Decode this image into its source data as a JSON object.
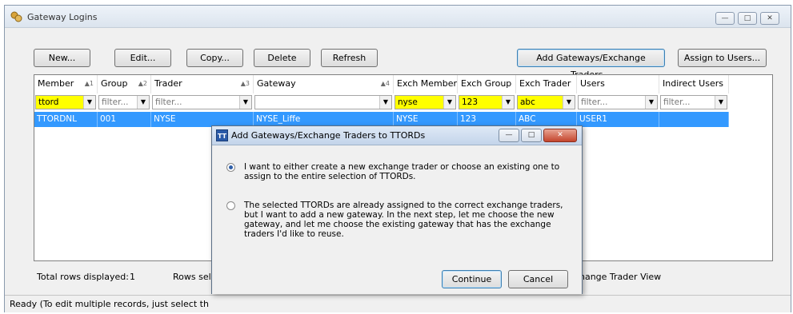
{
  "window": {
    "title": "Gateway Logins",
    "controls": [
      "minimize-icon",
      "maximize-icon",
      "close-icon"
    ]
  },
  "toolbar": {
    "new_label": "New...",
    "edit_label": "Edit...",
    "copy_label": "Copy...",
    "delete_label": "Delete",
    "refresh_label": "Refresh",
    "add_gateways_label": "Add Gateways/Exchange Traders...",
    "assign_users_label": "Assign to Users..."
  },
  "grid": {
    "columns": [
      {
        "label": "Member",
        "sort": "▲1"
      },
      {
        "label": "Group",
        "sort": "▲2"
      },
      {
        "label": "Trader",
        "sort": "▲3"
      },
      {
        "label": "Gateway",
        "sort": "▲4"
      },
      {
        "label": "Exch Member",
        "sort": ""
      },
      {
        "label": "Exch Group",
        "sort": ""
      },
      {
        "label": "Exch Trader",
        "sort": ""
      },
      {
        "label": "Users",
        "sort": ""
      },
      {
        "label": "Indirect Users",
        "sort": ""
      }
    ],
    "filters": [
      "ttord",
      "filter...",
      "filter...",
      "",
      "nyse",
      "123",
      "abc",
      "filter...",
      "filter..."
    ],
    "highlight_color": "#ffff00",
    "selected_row_color": "#3399ff",
    "rows": [
      [
        "TTORDNL",
        "001",
        "NYSE",
        "NYSE_Liffe",
        "NYSE",
        "123",
        "ABC",
        "USER1",
        ""
      ]
    ]
  },
  "footer": {
    "total_rows_label": "Total rows displayed:",
    "total_rows_value": "1",
    "rows_selected_partial": "Rows sele",
    "view_partial": "hange Trader View"
  },
  "status": {
    "text_partial": "Ready (To edit multiple records, just select th"
  },
  "dialog": {
    "title": "Add Gateways/Exchange Traders to TTORDs",
    "icon_text": "TT",
    "option1": "I want to either create a new exchange trader or choose an existing one to assign to the entire selection of TTORDs.",
    "option2": "The selected TTORDs are already assigned to the correct exchange traders, but I want to add a new gateway. In the next step, let me choose the new gateway, and let me choose the existing gateway that has the exchange traders I'd like to reuse.",
    "option1_checked": true,
    "continue_label": "Continue",
    "cancel_label": "Cancel"
  }
}
